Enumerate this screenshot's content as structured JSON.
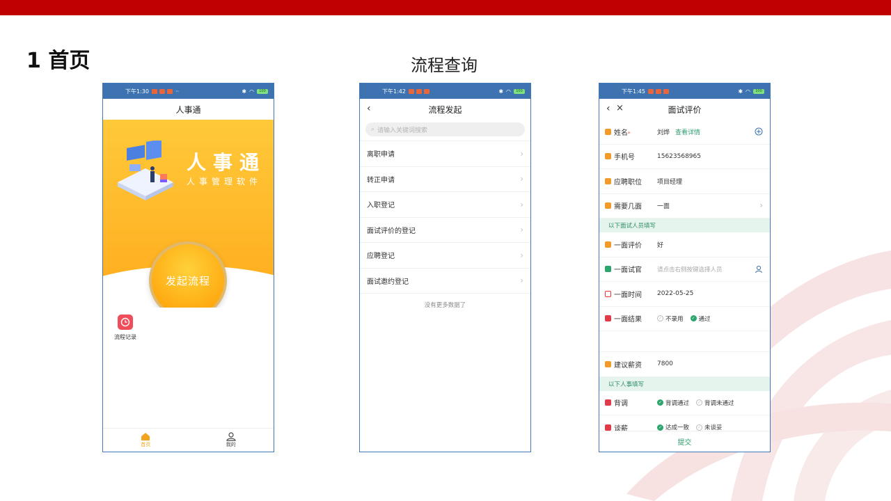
{
  "slide": {
    "title": "1 首页",
    "center_title": "流程查询",
    "colors": {
      "topbar": "#c00000",
      "accent_green": "#2f9e6e",
      "accent_orange": "#f3a41e"
    }
  },
  "phone1": {
    "status_time": "下午1:30",
    "battery": "100",
    "nav_title": "人事通",
    "hero_title": "人事通",
    "hero_subtitle": "人事管理软件",
    "start_button": "发起流程",
    "shortcut_label": "流程记录",
    "tabs": [
      {
        "label": "首页",
        "icon": "home-icon"
      },
      {
        "label": "我的",
        "icon": "user-icon"
      }
    ]
  },
  "phone2": {
    "status_time": "下午1:42",
    "battery": "100",
    "nav_title": "流程发起",
    "search_placeholder": "请输入关键词搜索",
    "items": [
      {
        "label": "离职申请"
      },
      {
        "label": "转正申请"
      },
      {
        "label": "入职登记"
      },
      {
        "label": "面试评价的登记"
      },
      {
        "label": "应聘登记"
      },
      {
        "label": "面试邀约登记"
      }
    ],
    "footer": "没有更多数据了"
  },
  "phone3": {
    "status_time": "下午1:45",
    "battery": "100",
    "nav_title": "面试评价",
    "name_label": "姓名",
    "name_value": "刘烨",
    "name_link": "查看详情",
    "phone_label": "手机号",
    "phone_value": "15623568965",
    "position_label": "应聘职位",
    "position_value": "项目经理",
    "rounds_label": "需要几面",
    "rounds_value": "一面",
    "section1": "以下面试人员填写",
    "eval_label": "一面评价",
    "eval_value": "好",
    "interviewer_label": "一面试官",
    "interviewer_placeholder": "请点击右侧按键选择人员",
    "time_label": "一面时间",
    "time_value": "2022-05-25",
    "result_label": "一面结果",
    "result_opt1": "不录用",
    "result_opt2": "通过",
    "salary_label": "建议薪资",
    "salary_value": "7800",
    "section2": "以下人事填写",
    "bg_label": "背调",
    "bg_opt1": "背调通过",
    "bg_opt2": "背调未通过",
    "negotiate_label": "谈薪",
    "negotiate_opt1": "达成一致",
    "negotiate_opt2": "未谈妥",
    "submit": "提交"
  }
}
